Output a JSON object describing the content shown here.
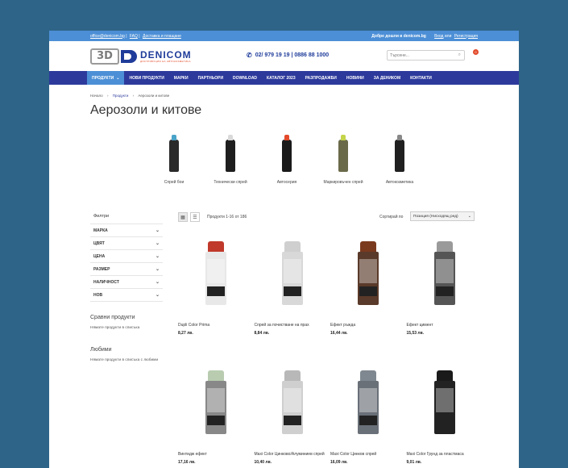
{
  "topbar": {
    "email": "office@denicom.bg",
    "faq": "FAQ",
    "delivery": "Доставка и плащане",
    "welcome": "Добре дошли в denicom.bg",
    "login": "Вход",
    "or": "или",
    "register": "Регистрация"
  },
  "header": {
    "logo_3d": "3D",
    "brand_name": "DENICOM",
    "brand_tag": "ДИСТРИБУЦИЯ НА АВТОКОЗМЕТИКА",
    "phone": "02/ 979 19 19 | 0886 88 1000",
    "search_placeholder": "Търсене...",
    "cart_count": "0"
  },
  "nav": {
    "items": [
      {
        "label": "ПРОДУКТИ"
      },
      {
        "label": "НОВИ ПРОДУКТИ"
      },
      {
        "label": "МАРКИ"
      },
      {
        "label": "ПАРТНЬОРИ"
      },
      {
        "label": "DOWNLOAD"
      },
      {
        "label": "КАТАЛОГ 2023"
      },
      {
        "label": "РАЗПРОДАЖБИ"
      },
      {
        "label": "НОВИНИ"
      },
      {
        "label": "ЗА ДЕНИКОМ"
      },
      {
        "label": "КОНТАКТИ"
      }
    ]
  },
  "breadcrumb": {
    "home": "Начало",
    "products": "Продукти",
    "current": "Аерозоли и китове"
  },
  "page_title": "Аерозоли и китове",
  "categories": [
    {
      "label": "Спрей бои",
      "color": "#2a2a2a",
      "cap": "#4aa3c8"
    },
    {
      "label": "Технически спрей",
      "color": "#1e1e1e",
      "cap": "#d9d9d9"
    },
    {
      "label": "Автосерия",
      "color": "#1a1a1a",
      "cap": "#e24a2b"
    },
    {
      "label": "Маркировъчен спрей",
      "color": "#6a6a4a",
      "cap": "#c4d44a"
    },
    {
      "label": "Автокозметика",
      "color": "#202020",
      "cap": "#888888"
    }
  ],
  "sidebar": {
    "filter_title": "Филтри",
    "filters": [
      "МАРКА",
      "ЦВЯТ",
      "ЦЕНА",
      "РАЗМЕР",
      "НАЛИЧНОСТ",
      "НОВ"
    ],
    "compare_title": "Сравни продукти",
    "compare_text": "Нямате продукти в списъка",
    "wishlist_title": "Любими",
    "wishlist_text": "Нямате продукти в списъка с любими"
  },
  "toolbar": {
    "count": "Продукти 1-16 от 186",
    "sort_label": "Сортирай по",
    "sort_value": "Позиция (Нисходящ ред)"
  },
  "products": [
    {
      "name": "Dupli Color Prima",
      "price": "8,27 лв.",
      "cap": "#c0392b",
      "body": "#e8e8e8"
    },
    {
      "name": "Спрей за почистване на прах",
      "price": "8,84 лв.",
      "cap": "#cfcfcf",
      "body": "#d8d8d8"
    },
    {
      "name": "Ефект ръжда",
      "price": "16,44 лв.",
      "cap": "#7a3a1e",
      "body": "#5a3a2a"
    },
    {
      "name": "Ефект цимент",
      "price": "15,53 лв.",
      "cap": "#9a9a9a",
      "body": "#555555"
    },
    {
      "name": "Винтидж ефект",
      "price": "17,16 лв.",
      "cap": "#b9ccb0",
      "body": "#888888"
    },
    {
      "name": "Maxi Color Цинково/Алуминиев спрей",
      "price": "10,40 лв.",
      "cap": "#b8b8b8",
      "body": "#cfcfcf"
    },
    {
      "name": "Maxi Color Цинков спрей",
      "price": "16,09 лв.",
      "cap": "#7f8890",
      "body": "#6a7078"
    },
    {
      "name": "Maxi Color Грунд за пластмаса",
      "price": "9,01 лв.",
      "cap": "#1a1a1a",
      "body": "#222222"
    }
  ]
}
